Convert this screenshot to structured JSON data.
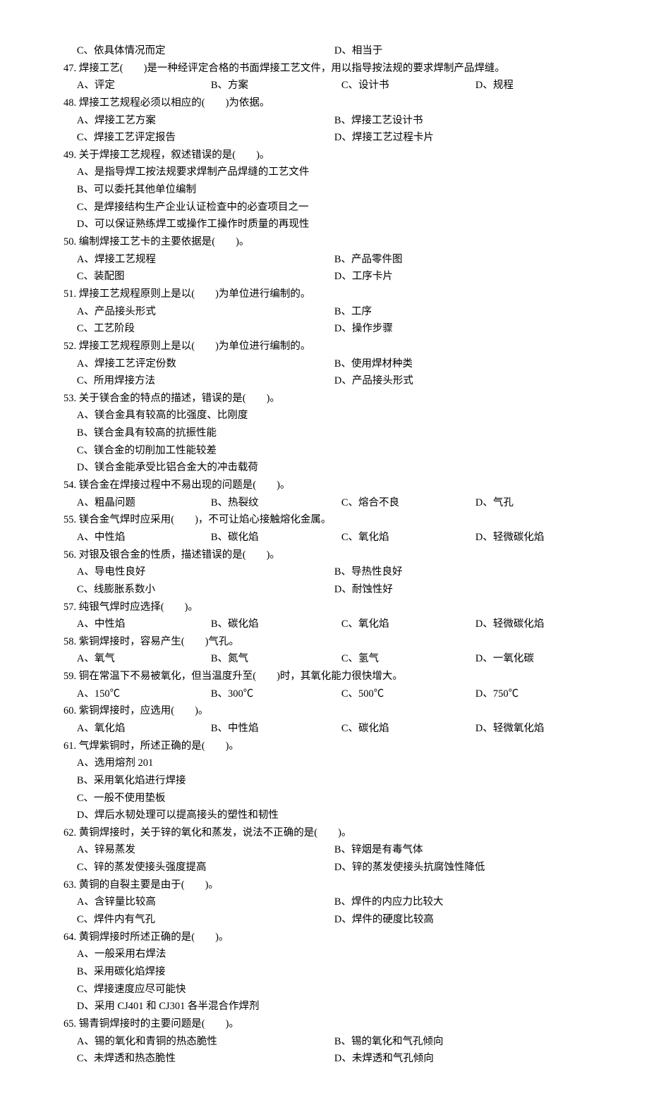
{
  "lines": [
    {
      "t": "opts2",
      "a": "C、依具体情况而定",
      "b": "D、相当于"
    },
    {
      "t": "stem",
      "txt": "47. 焊接工艺(　　)是一种经评定合格的书面焊接工艺文件，用以指导按法规的要求焊制产品焊缝。"
    },
    {
      "t": "opts4",
      "a": "A、评定",
      "b": "B、方案",
      "c": "C、设计书",
      "d": "D、规程"
    },
    {
      "t": "stem",
      "txt": "48. 焊接工艺规程必须以相应的(　　)为依据。"
    },
    {
      "t": "opts2",
      "a": "A、焊接工艺方案",
      "b": "B、焊接工艺设计书"
    },
    {
      "t": "opts2",
      "a": "C、焊接工艺评定报告",
      "b": "D、焊接工艺过程卡片"
    },
    {
      "t": "stem",
      "txt": "49. 关于焊接工艺规程，叙述错误的是(　　)。"
    },
    {
      "t": "ind",
      "txt": "A、是指导焊工按法规要求焊制产品焊缝的工艺文件"
    },
    {
      "t": "ind",
      "txt": "B、可以委托其他单位编制"
    },
    {
      "t": "ind",
      "txt": "C、是焊接结构生产企业认证检查中的必查项目之一"
    },
    {
      "t": "ind",
      "txt": "D、可以保证熟练焊工或操作工操作时质量的再现性"
    },
    {
      "t": "stem",
      "txt": "50. 编制焊接工艺卡的主要依据是(　　)。"
    },
    {
      "t": "opts2",
      "a": "A、焊接工艺规程",
      "b": "B、产品零件图"
    },
    {
      "t": "opts2",
      "a": "C、装配图",
      "b": "D、工序卡片"
    },
    {
      "t": "stem",
      "txt": "51. 焊接工艺规程原则上是以(　　)为单位进行编制的。"
    },
    {
      "t": "opts2",
      "a": "A、产品接头形式",
      "b": "B、工序"
    },
    {
      "t": "opts2",
      "a": "C、工艺阶段",
      "b": "D、操作步骤"
    },
    {
      "t": "stem",
      "txt": "52. 焊接工艺规程原则上是以(　　)为单位进行编制的。"
    },
    {
      "t": "opts2",
      "a": "A、焊接工艺评定份数",
      "b": "B、使用焊材种类"
    },
    {
      "t": "opts2",
      "a": "C、所用焊接方法",
      "b": "D、产品接头形式"
    },
    {
      "t": "stem",
      "txt": "53. 关于镁合金的特点的描述，错误的是(　　)。"
    },
    {
      "t": "ind",
      "txt": "A、镁合金具有较高的比强度、比刚度"
    },
    {
      "t": "ind",
      "txt": "B、镁合金具有较高的抗振性能"
    },
    {
      "t": "ind",
      "txt": "C、镁合金的切削加工性能较差"
    },
    {
      "t": "ind",
      "txt": "D、镁合金能承受比铝合金大的冲击载荷"
    },
    {
      "t": "stem",
      "txt": "54. 镁合金在焊接过程中不易出现的问题是(　　)。"
    },
    {
      "t": "opts4",
      "a": "A、粗晶问题",
      "b": "B、热裂纹",
      "c": "C、熔合不良",
      "d": "D、气孔"
    },
    {
      "t": "stem",
      "txt": "55. 镁合金气焊时应采用(　　)，不可让焰心接触熔化金属。"
    },
    {
      "t": "opts4",
      "a": "A、中性焰",
      "b": "B、碳化焰",
      "c": "C、氧化焰",
      "d": "D、轻微碳化焰"
    },
    {
      "t": "stem",
      "txt": "56. 对银及银合金的性质，描述错误的是(　　)。"
    },
    {
      "t": "opts2",
      "a": "A、导电性良好",
      "b": "B、导热性良好"
    },
    {
      "t": "opts2",
      "a": "C、线膨胀系数小",
      "b": "D、耐蚀性好"
    },
    {
      "t": "stem",
      "txt": "57. 纯银气焊时应选择(　　)。"
    },
    {
      "t": "opts4",
      "a": "A、中性焰",
      "b": "B、碳化焰",
      "c": "C、氧化焰",
      "d": "D、轻微碳化焰"
    },
    {
      "t": "stem",
      "txt": "58. 紫铜焊接时，容易产生(　　)气孔。"
    },
    {
      "t": "opts4",
      "a": "A、氧气",
      "b": "B、氮气",
      "c": "C、氢气",
      "d": "D、一氧化碳"
    },
    {
      "t": "stem",
      "txt": "59. 铜在常温下不易被氧化，但当温度升至(　　)时，其氧化能力很快增大。"
    },
    {
      "t": "opts4",
      "a": "A、150℃",
      "b": "B、300℃",
      "c": "C、500℃",
      "d": "D、750℃"
    },
    {
      "t": "stem",
      "txt": "60. 紫铜焊接时，应选用(　　)。"
    },
    {
      "t": "opts4",
      "a": "A、氧化焰",
      "b": "B、中性焰",
      "c": "C、碳化焰",
      "d": "D、轻微氧化焰"
    },
    {
      "t": "stem",
      "txt": "61. 气焊紫铜时，所述正确的是(　　)。"
    },
    {
      "t": "ind",
      "txt": "A、选用熔剂 201"
    },
    {
      "t": "ind",
      "txt": "B、采用氧化焰进行焊接"
    },
    {
      "t": "ind",
      "txt": "C、一般不使用垫板"
    },
    {
      "t": "ind",
      "txt": "D、焊后水韧处理可以提高接头的塑性和韧性"
    },
    {
      "t": "stem",
      "txt": "62. 黄铜焊接时，关于锌的氧化和蒸发，说法不正确的是(　　)。"
    },
    {
      "t": "opts2",
      "a": "A、锌易蒸发",
      "b": "B、锌烟是有毒气体"
    },
    {
      "t": "opts2",
      "a": "C、锌的蒸发使接头强度提高",
      "b": "D、锌的蒸发使接头抗腐蚀性降低"
    },
    {
      "t": "stem",
      "txt": "63. 黄铜的自裂主要是由于(　　)。"
    },
    {
      "t": "opts2",
      "a": "A、含锌量比较高",
      "b": "B、焊件的内应力比较大"
    },
    {
      "t": "opts2",
      "a": "C、焊件内有气孔",
      "b": "D、焊件的硬度比较高"
    },
    {
      "t": "stem",
      "txt": "64. 黄铜焊接时所述正确的是(　　)。"
    },
    {
      "t": "ind",
      "txt": "A、一般采用右焊法"
    },
    {
      "t": "ind",
      "txt": "B、采用碳化焰焊接"
    },
    {
      "t": "ind",
      "txt": "C、焊接速度应尽可能快"
    },
    {
      "t": "ind",
      "txt": "D、采用 CJ401 和 CJ301 各半混合作焊剂"
    },
    {
      "t": "stem",
      "txt": "65. 锡青铜焊接时的主要问题是(　　)。"
    },
    {
      "t": "opts2",
      "a": "A、锡的氧化和青铜的热态脆性",
      "b": "B、锡的氧化和气孔倾向"
    },
    {
      "t": "opts2",
      "a": "C、未焊透和热态脆性",
      "b": "D、未焊透和气孔倾向"
    }
  ]
}
